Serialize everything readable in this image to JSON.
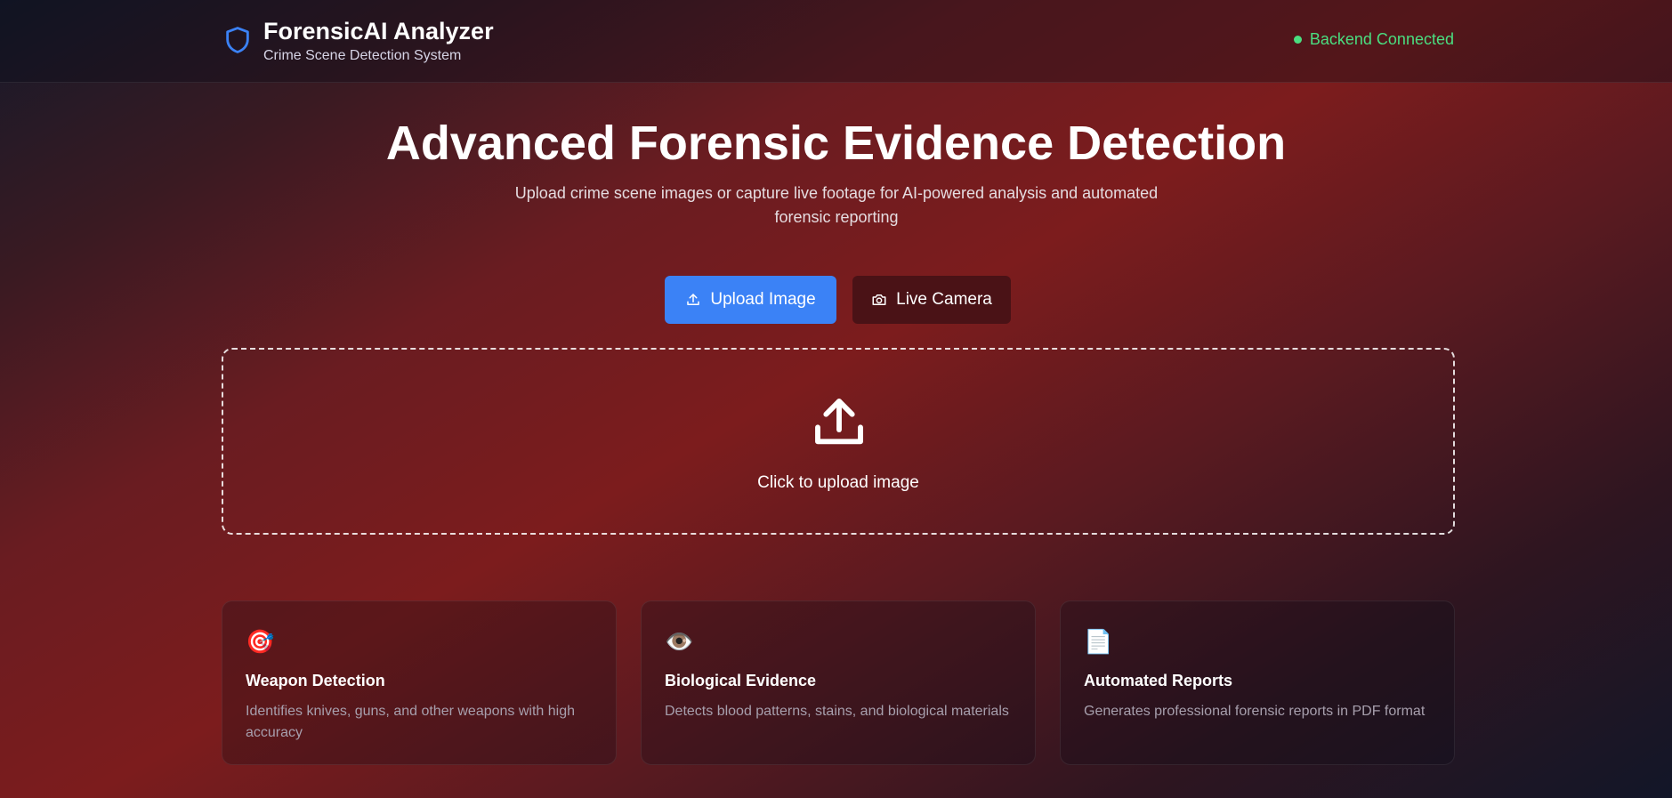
{
  "header": {
    "title": "ForensicAI Analyzer",
    "subtitle": "Crime Scene Detection System",
    "status": "Backend Connected",
    "logo_icon": "shield-icon"
  },
  "hero": {
    "title": "Advanced Forensic Evidence Detection",
    "subtitle": "Upload crime scene images or capture live footage for AI-powered analysis and automated forensic reporting"
  },
  "actions": {
    "upload_label": "Upload Image",
    "camera_label": "Live Camera"
  },
  "dropzone": {
    "label": "Click to upload image",
    "icon": "upload-icon"
  },
  "features": [
    {
      "icon": "🎯",
      "title": "Weapon Detection",
      "description": "Identifies knives, guns, and other weapons with high accuracy"
    },
    {
      "icon": "👁️",
      "title": "Biological Evidence",
      "description": "Detects blood patterns, stains, and biological materials"
    },
    {
      "icon": "📄",
      "title": "Automated Reports",
      "description": "Generates professional forensic reports in PDF format"
    }
  ],
  "colors": {
    "accent": "#3b82f6",
    "status": "#4ade80",
    "camera_button": "#4a1216"
  }
}
